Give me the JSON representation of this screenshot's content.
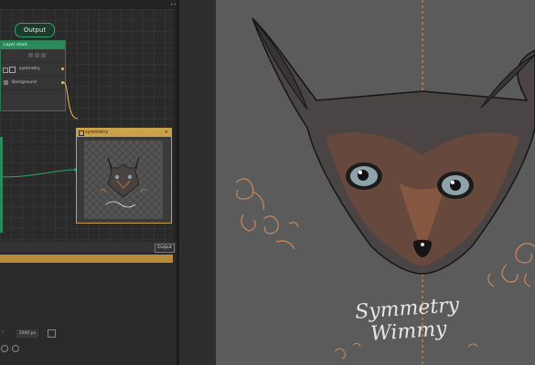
{
  "node_graph": {
    "output_node_label": "Output",
    "layer_stack": {
      "title": "Layer stack",
      "rows": [
        {
          "label": ""
        },
        {
          "label": "symmetry"
        },
        {
          "label": "Background"
        }
      ]
    },
    "symmetry_node": {
      "title": "symmetry"
    }
  },
  "properties": {
    "output_tag": "Output",
    "size_value": "2000 px"
  },
  "canvas": {
    "artwork_text": "Symmetry Wimmy",
    "colors": {
      "background": "#5b5b5b",
      "ink": "#151515",
      "orange": "#c98a5c",
      "guide": "#d59a5a"
    }
  },
  "colors": {
    "accent_green": "#2a8a5b",
    "accent_gold": "#c9a24a"
  }
}
